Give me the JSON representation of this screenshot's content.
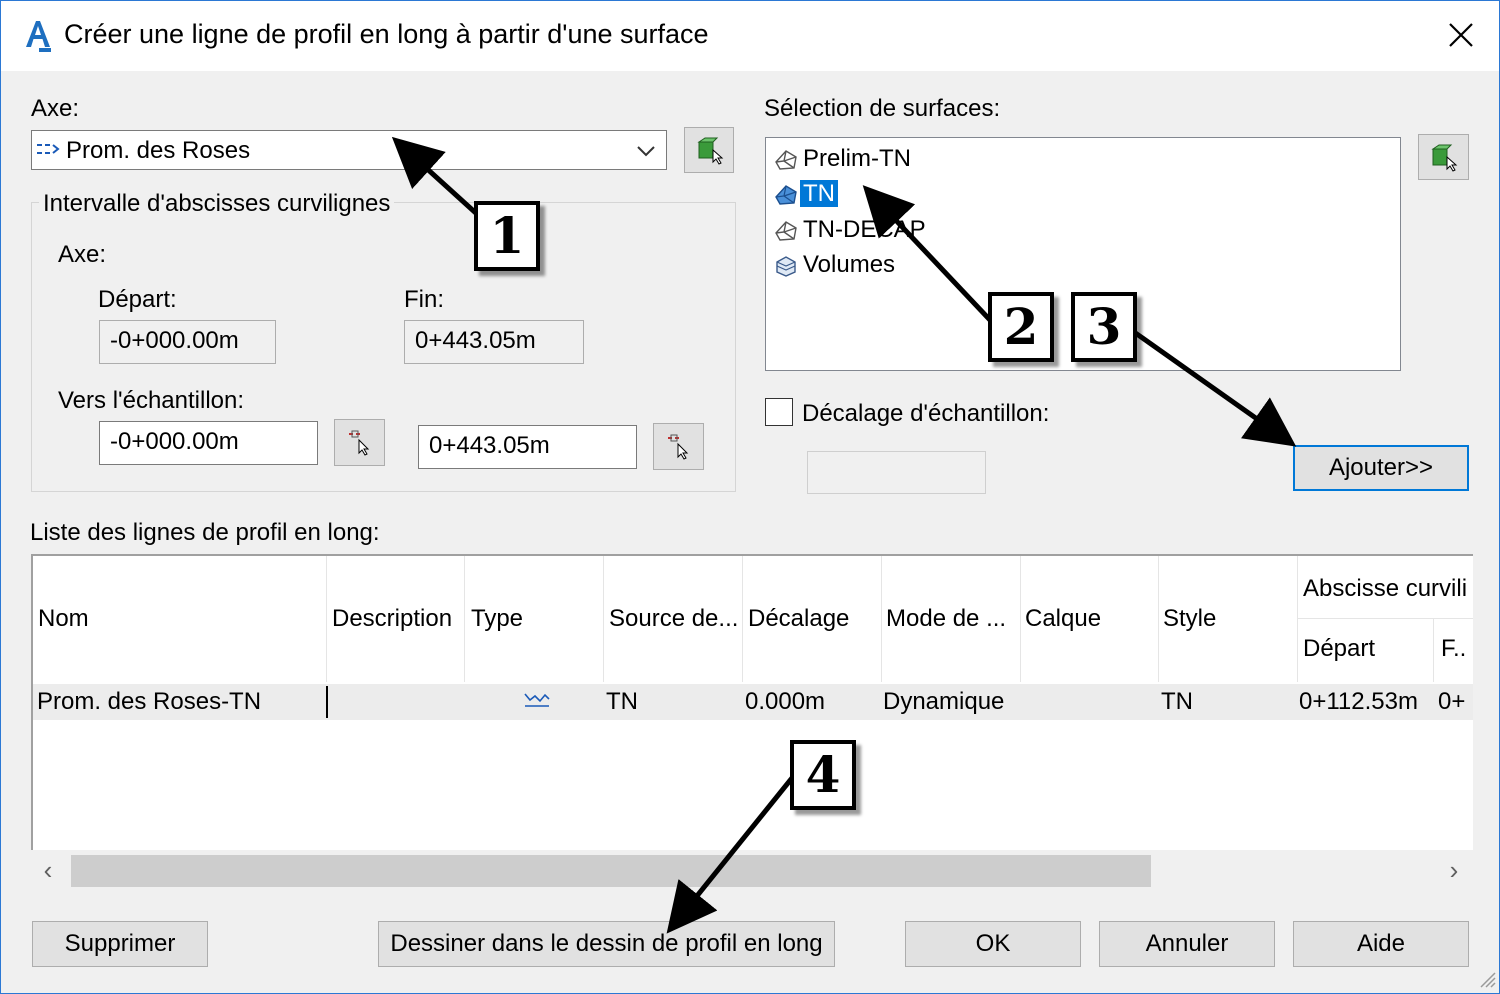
{
  "window": {
    "title": "Créer une ligne de profil en long à partir d'une surface"
  },
  "alignment": {
    "label": "Axe:",
    "selected": "Prom. des Roses"
  },
  "station_range": {
    "group_label": "Intervalle d'abscisses curvilignes",
    "axis_label": "Axe:",
    "start_label": "Départ:",
    "start_value": "-0+000.00m",
    "end_label": "Fin:",
    "end_value": "0+443.05m",
    "sample_label": "Vers l'échantillon:",
    "sample_start": "-0+000.00m",
    "sample_end": "0+443.05m"
  },
  "surfaces": {
    "label": "Sélection de surfaces:",
    "items": [
      {
        "name": "Prelim-TN",
        "icon": "surface-icon",
        "selected": false
      },
      {
        "name": "TN",
        "icon": "surface-icon",
        "selected": true
      },
      {
        "name": "TN-DECAP",
        "icon": "surface-icon",
        "selected": false
      },
      {
        "name": "Volumes",
        "icon": "volume-surface-icon",
        "selected": false
      }
    ],
    "offset_checkbox_label": "Décalage d'échantillon:",
    "offset_checked": false,
    "offset_value": "",
    "add_button": "Ajouter>>"
  },
  "profile_list": {
    "label": "Liste des lignes de profil en long:",
    "columns": [
      "Nom",
      "Description",
      "Type",
      "Source de...",
      "Décalage",
      "Mode de ...",
      "Calque",
      "Style"
    ],
    "group_header": "Abscisse curvili",
    "sub_columns": [
      "Départ",
      "F.."
    ],
    "rows": [
      {
        "name": "Prom. des Roses-TN",
        "description": "",
        "type_icon": "profile-type-icon",
        "source": "TN",
        "offset": "0.000m",
        "mode": "Dynamique",
        "layer": "",
        "style": "TN",
        "start": "0+112.53m",
        "end": "0+"
      }
    ]
  },
  "buttons": {
    "delete": "Supprimer",
    "draw": "Dessiner dans le dessin de profil en long",
    "ok": "OK",
    "cancel": "Annuler",
    "help": "Aide"
  },
  "callouts": [
    "1",
    "2",
    "3",
    "4"
  ],
  "colors": {
    "selection": "#0078d7",
    "default_button_border": "#0078d7",
    "background": "#f0f0f0"
  }
}
